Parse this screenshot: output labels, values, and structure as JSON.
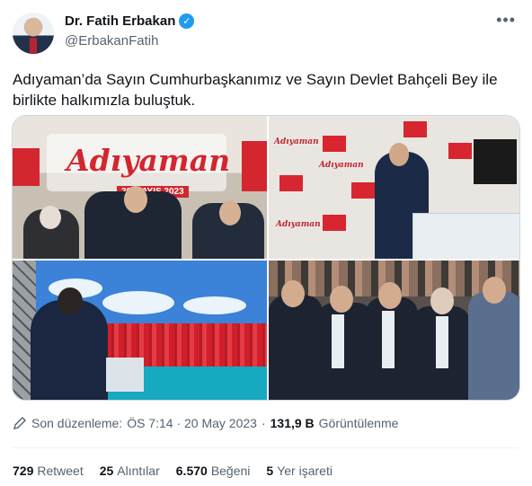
{
  "author": {
    "name": "Dr. Fatih Erbakan",
    "handle": "@ErbakanFatih",
    "verified": true
  },
  "tweet": {
    "text_line1": "Adıyaman’da Sayın Cumhurbaşkanımız ve Sayın Devlet Bahçeli Bey ile",
    "text_line2": "birlikte halkımızla buluştuk."
  },
  "media": {
    "photo1": {
      "title": "Adıyaman",
      "date": "20 MAYIS 2023"
    },
    "photo2": {
      "wall_label": "Adıyaman"
    }
  },
  "meta": {
    "edited_label": "Son düzenleme:",
    "timestamp": "ÖS 7:14 · 20 May 2023",
    "separator": "·",
    "views_count": "131,9 B",
    "views_label": "Görüntülenme"
  },
  "stats": [
    {
      "count": "729",
      "label": "Retweet"
    },
    {
      "count": "25",
      "label": "Alıntılar"
    },
    {
      "count": "6.570",
      "label": "Beğeni"
    },
    {
      "count": "5",
      "label": "Yer işareti"
    }
  ],
  "colors": {
    "verified": "#1d9bf0",
    "secondary_text": "#536471",
    "primary_text": "#0f1419"
  }
}
